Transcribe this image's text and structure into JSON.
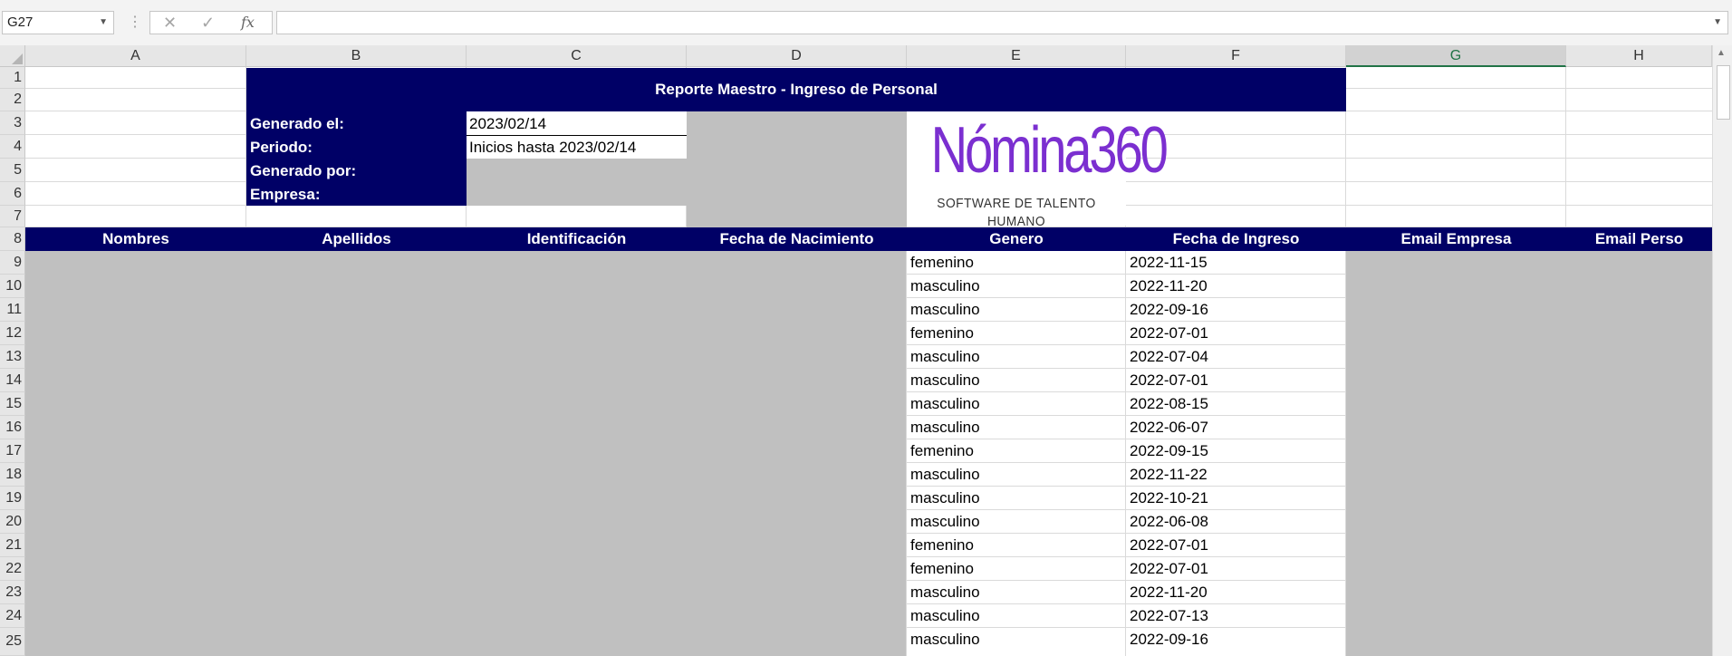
{
  "formula_bar": {
    "name_box": "G27",
    "formula": "",
    "cancel_icon": "close-icon",
    "enter_icon": "check-icon",
    "fx_label": "fx"
  },
  "columns": [
    "A",
    "B",
    "C",
    "D",
    "E",
    "F",
    "G",
    "H"
  ],
  "selected_column": "G",
  "rows": [
    "1",
    "2",
    "3",
    "4",
    "5",
    "6",
    "7",
    "8",
    "9",
    "10",
    "11",
    "12",
    "13",
    "14",
    "15",
    "16",
    "17",
    "18",
    "19",
    "20",
    "21",
    "22",
    "23",
    "24",
    "25"
  ],
  "report": {
    "title": "Reporte Maestro - Ingreso de Personal",
    "generado_label": "Generado el:",
    "generado_value": "2023/02/14",
    "periodo_label": "Periodo:",
    "periodo_value": "Inicios hasta 2023/02/14",
    "generado_por_label": "Generado por:",
    "empresa_label": "Empresa:"
  },
  "logo": {
    "text": "Nómina360",
    "tagline": "SOFTWARE DE TALENTO HUMANO"
  },
  "table": {
    "headers": [
      "Nombres",
      "Apellidos",
      "Identificación",
      "Fecha de Nacimiento",
      "Genero",
      "Fecha de Ingreso",
      "Email Empresa",
      "Email Perso"
    ],
    "rows": [
      {
        "genero": "femenino",
        "fecha_ingreso": "2022-11-15"
      },
      {
        "genero": "masculino",
        "fecha_ingreso": "2022-11-20"
      },
      {
        "genero": "masculino",
        "fecha_ingreso": "2022-09-16"
      },
      {
        "genero": "femenino",
        "fecha_ingreso": "2022-07-01"
      },
      {
        "genero": "masculino",
        "fecha_ingreso": "2022-07-04"
      },
      {
        "genero": "masculino",
        "fecha_ingreso": "2022-07-01"
      },
      {
        "genero": "masculino",
        "fecha_ingreso": "2022-08-15"
      },
      {
        "genero": "masculino",
        "fecha_ingreso": "2022-06-07"
      },
      {
        "genero": "femenino",
        "fecha_ingreso": "2022-09-15"
      },
      {
        "genero": "masculino",
        "fecha_ingreso": "2022-11-22"
      },
      {
        "genero": "masculino",
        "fecha_ingreso": "2022-10-21"
      },
      {
        "genero": "masculino",
        "fecha_ingreso": "2022-06-08"
      },
      {
        "genero": "femenino",
        "fecha_ingreso": "2022-07-01"
      },
      {
        "genero": "femenino",
        "fecha_ingreso": "2022-07-01"
      },
      {
        "genero": "masculino",
        "fecha_ingreso": "2022-11-20"
      },
      {
        "genero": "masculino",
        "fecha_ingreso": "2022-07-13"
      },
      {
        "genero": "masculino",
        "fecha_ingreso": "2022-09-16"
      }
    ]
  },
  "colors": {
    "navy": "#000066",
    "redacted": "#c0c0c0",
    "logo_purple": "#7b2fd0"
  }
}
